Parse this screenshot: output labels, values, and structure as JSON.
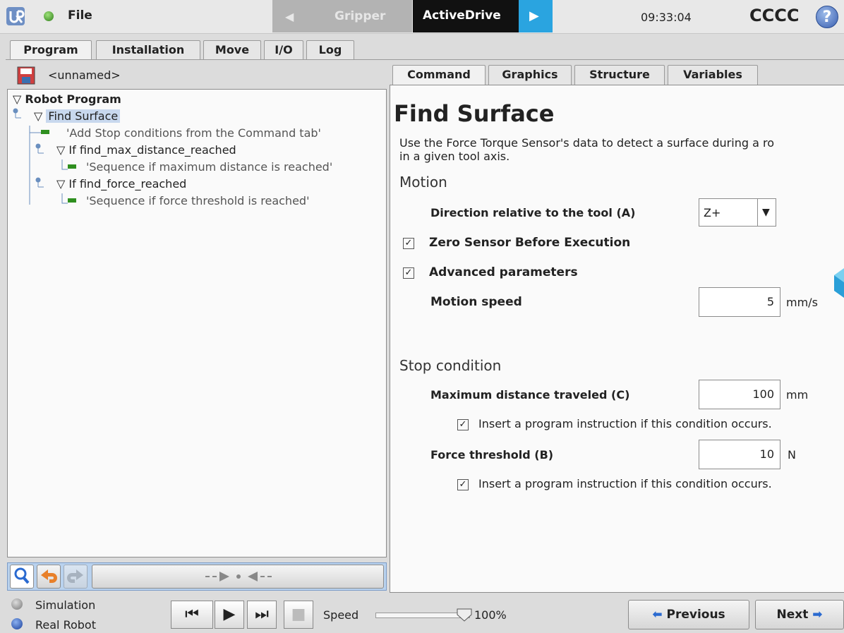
{
  "header": {
    "file_label": "File",
    "prev_tab": "Gripper",
    "active_tab": "ActiveDrive",
    "clock": "09:33:04",
    "robot_name": "CCCC",
    "help_label": "?"
  },
  "main_tabs": [
    "Program",
    "Installation",
    "Move",
    "I/O",
    "Log"
  ],
  "program": {
    "name": "<unnamed>"
  },
  "tree": {
    "root": "Robot Program",
    "find": "Find Surface",
    "add_stop": "'Add Stop conditions from the Command tab'",
    "if_max": "If find_max_distance_reached",
    "seq_max": "'Sequence if maximum distance is reached'",
    "if_force": "If find_force_reached",
    "seq_force": "'Sequence if force threshold is reached'"
  },
  "right_tabs": [
    "Command",
    "Graphics",
    "Structure",
    "Variables"
  ],
  "command": {
    "title": "Find Surface",
    "description": "Use the Force Torque Sensor's data to detect a surface during a ro\nin a given tool axis.",
    "motion_header": "Motion",
    "direction_label": "Direction relative to the tool (A)",
    "direction_value": "Z+",
    "zero_sensor_label": "Zero Sensor Before Execution",
    "advanced_label": "Advanced parameters",
    "speed_label": "Motion speed",
    "speed_value": "5",
    "speed_unit": "mm/s",
    "stop_header": "Stop condition",
    "max_dist_label": "Maximum distance traveled (C)",
    "max_dist_value": "100",
    "max_dist_unit": "mm",
    "insert_label_1": "Insert a program instruction if this condition occurs.",
    "force_label": "Force threshold (B)",
    "force_value": "10",
    "force_unit": "N",
    "insert_label_2": "Insert a program instruction if this condition occurs.",
    "checkmark": "✓"
  },
  "footer": {
    "simulation": "Simulation",
    "real_robot": "Real Robot",
    "speed_label": "Speed",
    "speed_pct": "100%",
    "speed_fraction": 1.0,
    "previous": "Previous",
    "next": "Next"
  },
  "colors": {
    "accent": "#2aa4e0",
    "selection": "#c8d8ee",
    "tree_arrow": "#4a7a3a"
  }
}
